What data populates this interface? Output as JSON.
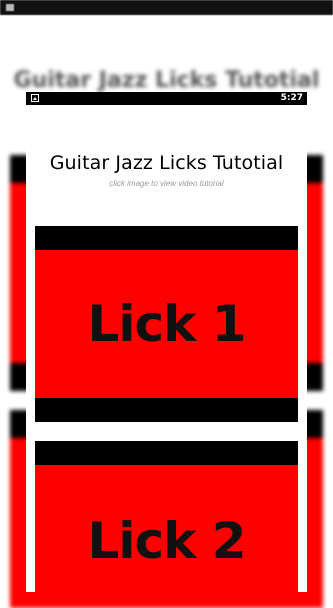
{
  "status_bar": {
    "time": "5:27"
  },
  "app": {
    "title": "Guitar Jazz Licks Tutotial",
    "subtitle": "click image to view video tutorial"
  },
  "items": [
    {
      "label": "Lick 1"
    },
    {
      "label": "Lick 2"
    }
  ],
  "colors": {
    "thumb_bg": "#ff0000",
    "thumb_bar": "#000000",
    "status_bar": "#000000"
  }
}
